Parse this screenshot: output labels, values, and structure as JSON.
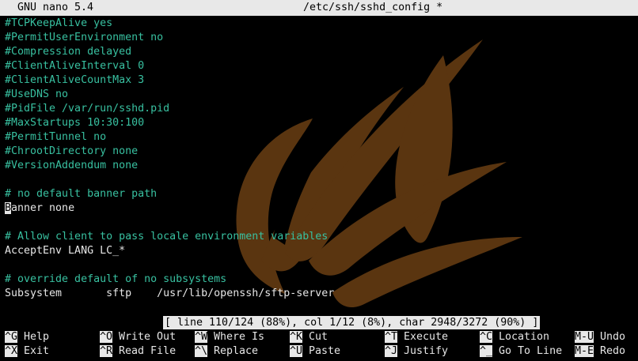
{
  "title": {
    "program": "GNU nano 5.4",
    "file": "/etc/ssh/sshd_config *"
  },
  "editor": {
    "lines": [
      {
        "text": "#TCPKeepAlive yes",
        "type": "comment"
      },
      {
        "text": "#PermitUserEnvironment no",
        "type": "comment"
      },
      {
        "text": "#Compression delayed",
        "type": "comment"
      },
      {
        "text": "#ClientAliveInterval 0",
        "type": "comment"
      },
      {
        "text": "#ClientAliveCountMax 3",
        "type": "comment"
      },
      {
        "text": "#UseDNS no",
        "type": "comment"
      },
      {
        "text": "#PidFile /var/run/sshd.pid",
        "type": "comment"
      },
      {
        "text": "#MaxStartups 10:30:100",
        "type": "comment"
      },
      {
        "text": "#PermitTunnel no",
        "type": "comment"
      },
      {
        "text": "#ChrootDirectory none",
        "type": "comment"
      },
      {
        "text": "#VersionAddendum none",
        "type": "comment"
      },
      {
        "text": "",
        "type": "blank"
      },
      {
        "text": "# no default banner path",
        "type": "comment"
      },
      {
        "cursor_char": "B",
        "rest": "anner none",
        "type": "cursor"
      },
      {
        "text": "",
        "type": "blank"
      },
      {
        "text": "# Allow client to pass locale environment variables",
        "type": "comment"
      },
      {
        "text": "AcceptEnv LANG LC_*",
        "type": "plain"
      },
      {
        "text": "",
        "type": "blank"
      },
      {
        "text": "# override default of no subsystems",
        "type": "comment"
      },
      {
        "text": "Subsystem       sftp    /usr/lib/openssh/sftp-server",
        "type": "plain"
      }
    ]
  },
  "status": "[ line 110/124 (88%), col 1/12 (8%), char 2948/3272 (90%) ]",
  "shortcuts": [
    {
      "key": "^G",
      "label": " Help"
    },
    {
      "key": "^O",
      "label": " Write Out"
    },
    {
      "key": "^W",
      "label": " Where Is"
    },
    {
      "key": "^K",
      "label": " Cut"
    },
    {
      "key": "^T",
      "label": " Execute"
    },
    {
      "key": "^C",
      "label": " Location"
    },
    {
      "key": "M-U",
      "label": " Undo"
    },
    {
      "key": "^X",
      "label": " Exit"
    },
    {
      "key": "^R",
      "label": " Read File"
    },
    {
      "key": "^\\",
      "label": " Replace"
    },
    {
      "key": "^U",
      "label": " Paste"
    },
    {
      "key": "^J",
      "label": " Justify"
    },
    {
      "key": "^_",
      "label": " Go To Line"
    },
    {
      "key": "M-E",
      "label": " Redo"
    }
  ],
  "colors": {
    "background": "#000000",
    "comment": "#38c0a0",
    "text": "#e6e6e6",
    "bar": "#e8e8e8",
    "watermark": "#5a3510"
  },
  "watermark_icon": "leaf-logo-icon"
}
